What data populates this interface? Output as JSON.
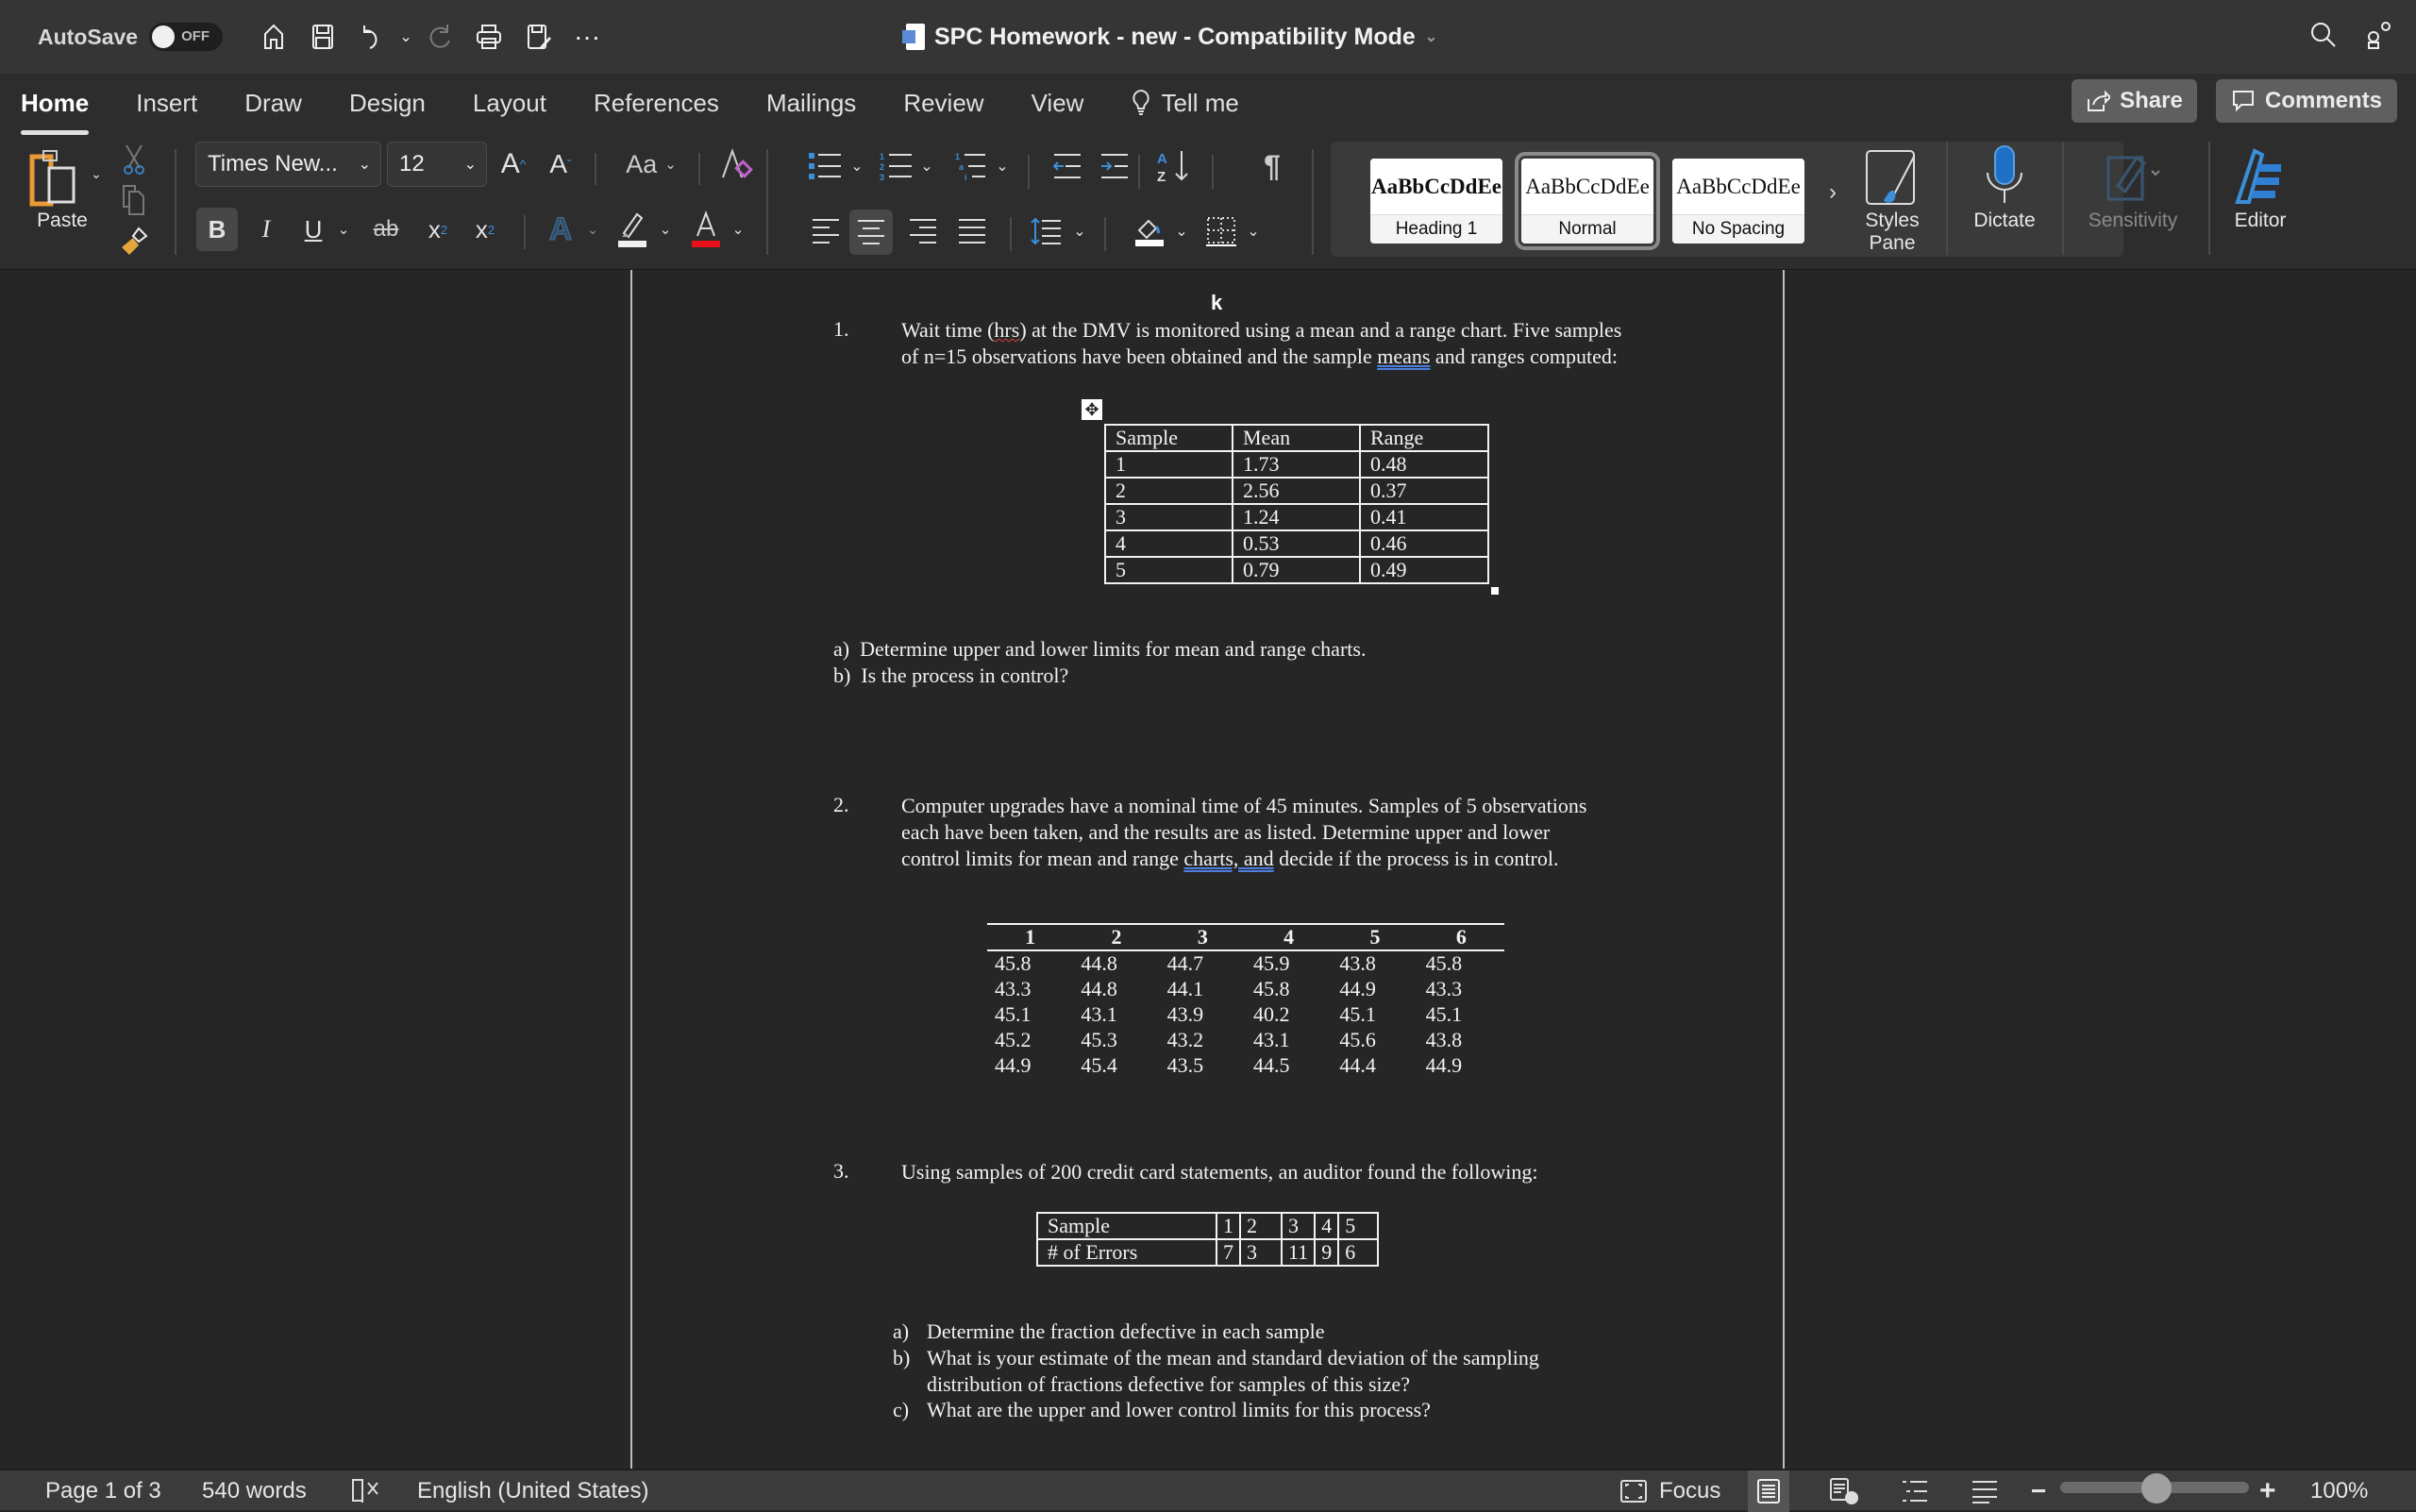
{
  "titlebar": {
    "autosave_label": "AutoSave",
    "autosave_state": "OFF",
    "quick_access": [
      "home-icon",
      "save-icon",
      "undo-icon",
      "redo-icon",
      "print-icon",
      "save-as-icon",
      "more-icon"
    ],
    "more_glyph": "···",
    "document_title": "SPC Homework - new  -  Compatibility Mode"
  },
  "tabs": [
    {
      "label": "Home",
      "active": true
    },
    {
      "label": "Insert"
    },
    {
      "label": "Draw"
    },
    {
      "label": "Design"
    },
    {
      "label": "Layout"
    },
    {
      "label": "References"
    },
    {
      "label": "Mailings"
    },
    {
      "label": "Review"
    },
    {
      "label": "View"
    }
  ],
  "tell_me": "Tell me",
  "share_label": "Share",
  "comments_label": "Comments",
  "ribbon": {
    "paste_label": "Paste",
    "font_name": "Times New...",
    "font_size": "12",
    "change_case": "Aa",
    "bold": "B",
    "italic": "I",
    "underline": "U",
    "strikethrough": "ab",
    "subscript": "x",
    "superscript": "x",
    "pilcrow": "¶",
    "styles": [
      {
        "sample": "AaBbCcDdEe",
        "name": "Heading 1",
        "bold": true
      },
      {
        "sample": "AaBbCcDdEe",
        "name": "Normal",
        "selected": true
      },
      {
        "sample": "AaBbCcDdEe",
        "name": "No Spacing"
      }
    ],
    "styles_pane_label": "Styles Pane",
    "dictate_label": "Dictate",
    "sensitivity_label": "Sensitivity",
    "editor_label": "Editor",
    "colors": {
      "highlight": "#f0f0f0",
      "font_color": "#e8101a",
      "accent": "#3a8fd9"
    }
  },
  "document": {
    "q1": {
      "number": "1.",
      "text_pre": "Wait time (",
      "text_hrs": "hrs",
      "text_mid": ") at the DMV is monitored using a mean and a range chart.  Five samples of n=15 observations have been obtained and the sample ",
      "text_means": "means",
      "text_post": " and ranges computed:",
      "table": {
        "headers": [
          "Sample",
          "Mean",
          "Range"
        ],
        "rows": [
          [
            "1",
            "1.73",
            "0.48"
          ],
          [
            "2",
            "2.56",
            "0.37"
          ],
          [
            "3",
            "1.24",
            "0.41"
          ],
          [
            "4",
            "0.53",
            "0.46"
          ],
          [
            "5",
            "0.79",
            "0.49"
          ]
        ]
      },
      "parts": [
        {
          "label": "a)",
          "text": "Determine upper and lower limits for mean and range charts."
        },
        {
          "label": "b)",
          "text": "Is the process in control?"
        }
      ]
    },
    "q2": {
      "number": "2.",
      "text_pre": "Computer upgrades have a nominal time of 45 minutes.  Samples of 5 observations each have been taken, and the results are as listed.  Determine upper and lower control limits for mean and range ",
      "text_charts": "charts, and",
      "text_post": " decide if the process is in control.",
      "table": {
        "headers": [
          "1",
          "2",
          "3",
          "4",
          "5",
          "6"
        ],
        "rows": [
          [
            "45.8",
            "44.8",
            "44.7",
            "45.9",
            "43.8",
            "45.8"
          ],
          [
            "43.3",
            "44.8",
            "44.1",
            "45.8",
            "44.9",
            "43.3"
          ],
          [
            "45.1",
            "43.1",
            "43.9",
            "40.2",
            "45.1",
            "45.1"
          ],
          [
            "45.2",
            "45.3",
            "43.2",
            "43.1",
            "45.6",
            "43.8"
          ],
          [
            "44.9",
            "45.4",
            "43.5",
            "44.5",
            "44.4",
            "44.9"
          ]
        ]
      }
    },
    "q3": {
      "number": "3.",
      "text": "Using samples of 200 credit card statements, an auditor found the following:",
      "table": {
        "row1": [
          "Sample",
          "1",
          "2",
          "3",
          "4",
          "5"
        ],
        "row2": [
          "# of Errors",
          "7",
          "3",
          "11",
          "9",
          "6"
        ]
      },
      "parts": [
        {
          "label": "a)",
          "text": "Determine the fraction defective in each sample"
        },
        {
          "label": "b)",
          "text": "What is your estimate of the mean and standard deviation of the sampling distribution of fractions defective for samples of this size?"
        },
        {
          "label": "c)",
          "text": "What are the upper and lower control limits for this process?"
        }
      ]
    },
    "cursor_glyph": "k"
  },
  "statusbar": {
    "page": "Page 1 of 3",
    "words": "540 words",
    "language": "English (United States)",
    "focus": "Focus",
    "zoom_minus": "−",
    "zoom_plus": "+",
    "zoom_level": "100%",
    "zoom_fraction": 0.5
  }
}
